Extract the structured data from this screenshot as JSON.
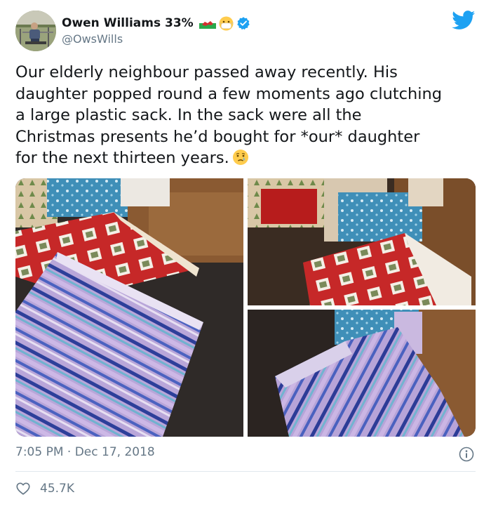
{
  "author": {
    "name": "Owen Williams 33%",
    "handle": "@OwsWills",
    "verified": true
  },
  "tweet": {
    "lines": [
      "Our elderly neighbour passed away recently. His",
      "daughter popped round a few moments ago clutching",
      "a large plastic sack. In the sack were all the",
      "Christmas presents he’d bought for *our* daughter",
      "for the next thirteen years."
    ]
  },
  "timestamp": "7:05 PM · Dec 17, 2018",
  "likes": {
    "count": "45.7K"
  },
  "icons": {
    "brand": "twitter-bird-icon",
    "verified": "verified-badge-icon",
    "info": "info-icon",
    "like": "heart-icon"
  },
  "colors": {
    "twitter_blue": "#1da1f2",
    "text_primary": "#14171a",
    "text_secondary": "#657786",
    "divider": "#e1e8ed"
  }
}
